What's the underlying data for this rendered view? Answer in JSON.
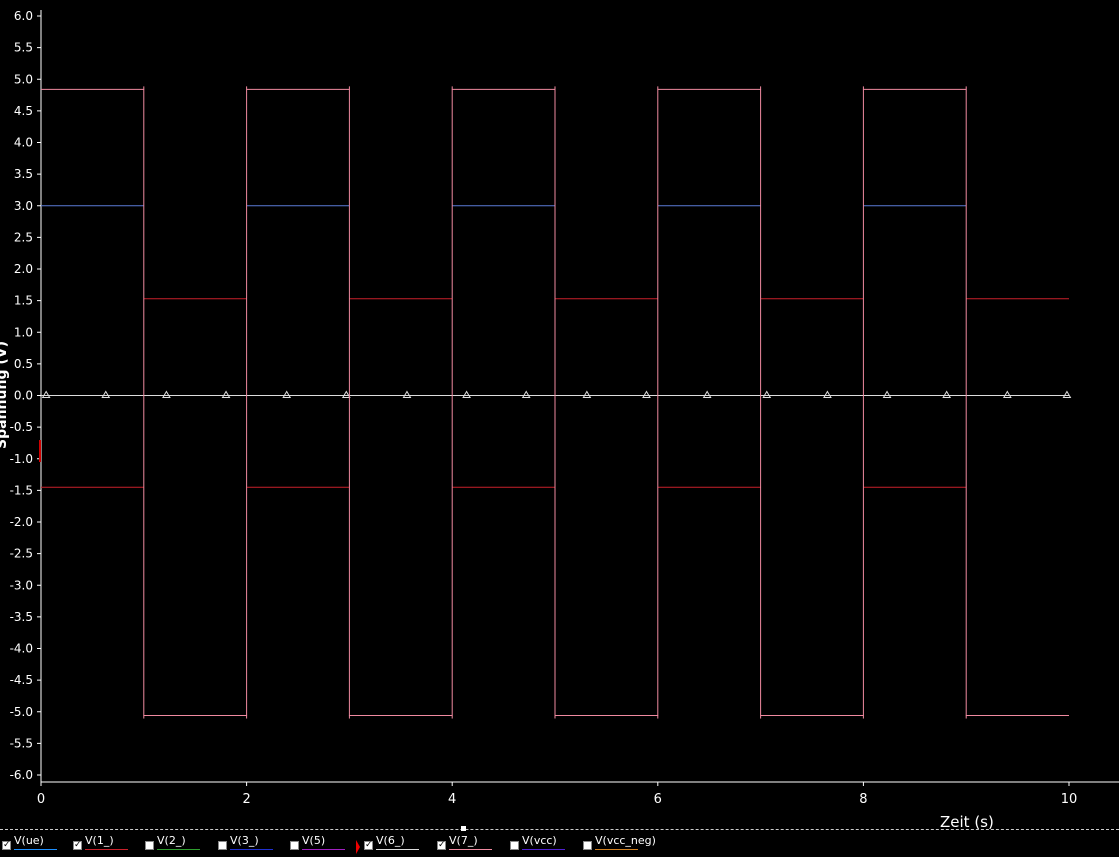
{
  "chart_data": {
    "type": "line",
    "title": "",
    "xlabel": "Zeit (s)",
    "ylabel": "Spannung (V)",
    "xlim": [
      0,
      10
    ],
    "ylim": [
      -6.0,
      6.0
    ],
    "x_ticks": [
      "0",
      "2",
      "4",
      "6",
      "8",
      "10"
    ],
    "y_ticks": [
      "6.0",
      "5.5",
      "5.0",
      "4.5",
      "4.0",
      "3.5",
      "3.0",
      "2.5",
      "2.0",
      "1.5",
      "1.0",
      "0.5",
      "0.0",
      "-0.5",
      "-1.0",
      "-1.5",
      "-2.0",
      "-2.5",
      "-3.0",
      "-3.5",
      "-4.0",
      "-4.5",
      "-5.0",
      "-5.5",
      "-6.0"
    ],
    "grid": false,
    "series": [
      {
        "name": "V(ue)",
        "color": "#5b7bd5",
        "segments": [
          [
            [
              0,
              3.0
            ],
            [
              1,
              3.0
            ]
          ],
          [
            [
              2,
              3.0
            ],
            [
              3,
              3.0
            ]
          ],
          [
            [
              4,
              3.0
            ],
            [
              5,
              3.0
            ]
          ],
          [
            [
              6,
              3.0
            ],
            [
              7,
              3.0
            ]
          ],
          [
            [
              8,
              3.0
            ],
            [
              9,
              3.0
            ]
          ]
        ]
      },
      {
        "name": "V(1_)",
        "color": "#c8202a",
        "segments": [
          [
            [
              0,
              -1.45
            ],
            [
              1,
              -1.45
            ]
          ],
          [
            [
              1,
              1.53
            ],
            [
              2,
              1.53
            ]
          ],
          [
            [
              2,
              -1.45
            ],
            [
              3,
              -1.45
            ]
          ],
          [
            [
              3,
              1.53
            ],
            [
              4,
              1.53
            ]
          ],
          [
            [
              4,
              -1.45
            ],
            [
              5,
              -1.45
            ]
          ],
          [
            [
              5,
              1.53
            ],
            [
              6,
              1.53
            ]
          ],
          [
            [
              6,
              -1.45
            ],
            [
              7,
              -1.45
            ]
          ],
          [
            [
              7,
              1.53
            ],
            [
              8,
              1.53
            ]
          ],
          [
            [
              8,
              -1.45
            ],
            [
              9,
              -1.45
            ]
          ],
          [
            [
              9,
              1.53
            ],
            [
              10,
              1.53
            ]
          ]
        ]
      },
      {
        "name": "V(6_)",
        "color": "#dddddd",
        "marker": "triangle",
        "points": [
          [
            0,
            0
          ],
          [
            10,
            0
          ]
        ],
        "marker_x": [
          0.05,
          0.63,
          1.22,
          1.8,
          2.39,
          2.97,
          3.56,
          4.14,
          4.72,
          5.31,
          5.89,
          6.48,
          7.06,
          7.65,
          8.23,
          8.81,
          9.4,
          9.98
        ]
      },
      {
        "name": "V(7_)",
        "color": "#f08aa0",
        "points": [
          [
            0,
            4.84
          ],
          [
            1.0,
            4.84
          ],
          [
            1.0,
            -5.06
          ],
          [
            2.0,
            -5.06
          ],
          [
            2.0,
            4.84
          ],
          [
            3.0,
            4.84
          ],
          [
            3.0,
            -5.06
          ],
          [
            4.0,
            -5.06
          ],
          [
            4.0,
            4.84
          ],
          [
            5.0,
            4.84
          ],
          [
            5.0,
            -5.06
          ],
          [
            6.0,
            -5.06
          ],
          [
            6.0,
            4.84
          ],
          [
            7.0,
            4.84
          ],
          [
            7.0,
            -5.06
          ],
          [
            8.0,
            -5.06
          ],
          [
            8.0,
            4.84
          ],
          [
            9.0,
            4.84
          ],
          [
            9.0,
            -5.06
          ],
          [
            10.0,
            -5.06
          ]
        ]
      }
    ]
  },
  "legend": [
    {
      "label": "V(ue)",
      "checked": true,
      "color": "#1e90ff"
    },
    {
      "label": "V(1_)",
      "checked": true,
      "color": "#c8202a"
    },
    {
      "label": "V(2_)",
      "checked": false,
      "color": "#2e9e2e"
    },
    {
      "label": "V(3_)",
      "checked": false,
      "color": "#2030d0"
    },
    {
      "label": "V(5)",
      "checked": false,
      "color": "#a020c0"
    },
    {
      "label": "V(6_)",
      "checked": true,
      "color": "#dddddd"
    },
    {
      "label": "V(7_)",
      "checked": true,
      "color": "#f08aa0"
    },
    {
      "label": "V(vcc)",
      "checked": false,
      "color": "#5020d0"
    },
    {
      "label": "V(vcc_neg)",
      "checked": false,
      "color": "#d08020"
    }
  ]
}
